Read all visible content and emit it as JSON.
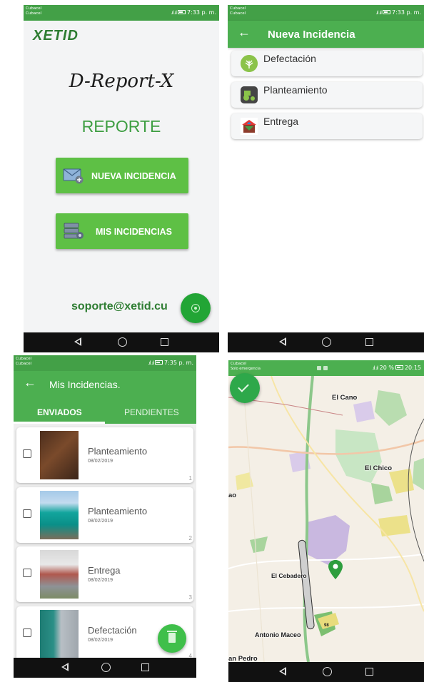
{
  "screen1": {
    "status": {
      "carrier1": "Cubacel",
      "carrier2": "Cubacel",
      "signal": ".ıl .ıl",
      "time": "7:33 p. m."
    },
    "logo": "XETID",
    "app_title": "D-Report-X",
    "section": "REPORTE",
    "buttons": {
      "new_incident": "NUEVA INCIDENCIA",
      "my_incidents": "MIS INCIDENCIAS"
    },
    "support_email": "soporte@xetid.cu"
  },
  "screen2": {
    "status": {
      "carrier1": "Cubacel",
      "carrier2": "Cubacel",
      "signal": ".ıl .ıl",
      "time": "7:33 p. m."
    },
    "back": "←",
    "title": "Nueva Incidencia",
    "types": [
      {
        "label": "Defectación"
      },
      {
        "label": "Planteamiento"
      },
      {
        "label": "Entrega"
      }
    ]
  },
  "screen3": {
    "status": {
      "carrier1": "Cubacel",
      "carrier2": "Cubacel",
      "signal": ".ıl .ıl",
      "time": "7:35 p. m."
    },
    "back": "←",
    "title": "Mis Incidencias.",
    "tabs": {
      "sent": "ENVIADOS",
      "pending": "PENDIENTES"
    },
    "reports": [
      {
        "title": "Planteamiento",
        "date": "08/02/2019",
        "num": "1"
      },
      {
        "title": "Planteamiento",
        "date": "08/02/2019",
        "num": "2"
      },
      {
        "title": "Entrega",
        "date": "08/02/2019",
        "num": "3"
      },
      {
        "title": "Defectación",
        "date": "08/02/2019",
        "num": "4"
      }
    ]
  },
  "screen4": {
    "status": {
      "carrier1": "Cubacel",
      "carrier2": "Solo emergencia",
      "signal": ".ıl .ıl",
      "battery": "20 %",
      "time": "20:15"
    },
    "labels": {
      "el_cano": "El Cano",
      "el_chico": "El Chico",
      "ao": "ao",
      "el_cebadero": "El Cebadero",
      "antonio_maceo": "Antonio Maceo",
      "san_pedro": "an Pedro",
      "road_98": "98"
    }
  },
  "colors": {
    "primary": "#4caf50",
    "status": "#43a047",
    "button": "#5ec045",
    "text_green": "#2e7d32"
  }
}
